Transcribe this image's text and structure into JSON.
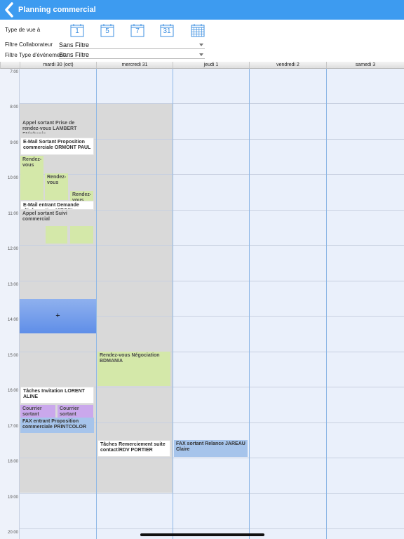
{
  "header": {
    "title": "Planning commercial"
  },
  "controls": {
    "view_type_label": "Type de vue à",
    "view_buttons": [
      {
        "name": "view-1-day-button",
        "label": "1"
      },
      {
        "name": "view-5-days-button",
        "label": "5"
      },
      {
        "name": "view-7-days-button",
        "label": "7"
      },
      {
        "name": "view-31-days-button",
        "label": "31"
      },
      {
        "name": "view-month-grid-button",
        "label": ""
      }
    ],
    "collaborator_filter": {
      "label": "Filtre Collaborateur",
      "value": "Sans Filtre"
    },
    "event_type_filter": {
      "label": "Filtre Type d'événement",
      "value": "Sans Filtre"
    }
  },
  "calendar": {
    "days": [
      "mardi 30 (oct)",
      "mercredi 31",
      "jeudi 1",
      "vendredi 2",
      "samedi 3"
    ],
    "hours": [
      "7:00",
      "8:00",
      "9:00",
      "10:00",
      "11:00",
      "12:00",
      "13:00",
      "14:00",
      "15:00",
      "16:00",
      "17:00",
      "18:00",
      "19:00",
      "20:00"
    ],
    "selection_symbol": "+",
    "events": [
      {
        "text": "Appel sortant Prise de rendez-vous LAMBERT Stéphanie",
        "day": 0,
        "color": "gray"
      },
      {
        "text": "E-Mail Sortant Proposition commerciale ORMONT PAUL",
        "day": 0,
        "color": "white"
      },
      {
        "text": "Rendez-vous",
        "day": 0,
        "color": "green"
      },
      {
        "text": "Rendez-vous",
        "day": 0,
        "color": "green"
      },
      {
        "text": "Rendez-vous",
        "day": 0,
        "color": "green"
      },
      {
        "text": "E-Mail entrant Demande d'information VIRGIN Frédéric",
        "day": 0,
        "color": "white"
      },
      {
        "text": "Appel sortant Suivi commercial",
        "day": 0,
        "color": "gray"
      },
      {
        "text": "",
        "day": 0,
        "color": "green"
      },
      {
        "text": "",
        "day": 0,
        "color": "green"
      },
      {
        "text": "Tâches Invitation LORENT ALINE",
        "day": 0,
        "color": "white"
      },
      {
        "text": "Courrier sortant",
        "day": 0,
        "color": "purple"
      },
      {
        "text": "Courrier sortant",
        "day": 0,
        "color": "purple"
      },
      {
        "text": "FAX entrant Proposition commerciale PRINTCOLOR",
        "day": 0,
        "color": "blue"
      },
      {
        "text": "Rendez-vous Négociation BDMANIA",
        "day": 1,
        "color": "green"
      },
      {
        "text": "Tâches Remerciement suite contact/RDV PORTIER",
        "day": 1,
        "color": "white"
      },
      {
        "text": "FAX sortant Relance JAREAU Claire",
        "day": 2,
        "color": "blue"
      }
    ]
  }
}
